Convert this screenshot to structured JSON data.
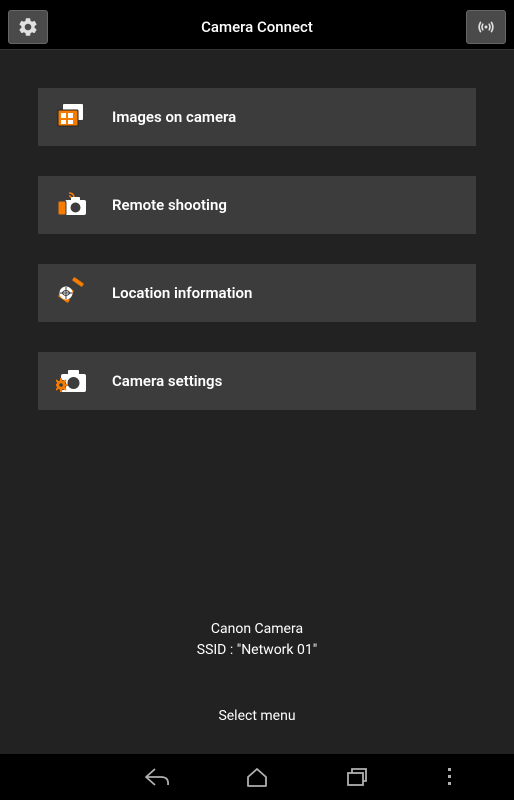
{
  "header": {
    "title": "Camera Connect"
  },
  "menu": {
    "items": [
      {
        "label": "Images on camera",
        "icon": "images-icon"
      },
      {
        "label": "Remote shooting",
        "icon": "remote-icon"
      },
      {
        "label": "Location information",
        "icon": "location-icon"
      },
      {
        "label": "Camera settings",
        "icon": "settings-icon"
      }
    ]
  },
  "status": {
    "device": "Canon Camera",
    "ssid_line": "SSID : \"Network 01\""
  },
  "prompt": "Select menu",
  "colors": {
    "accent": "#f57c00",
    "bg": "#222222",
    "item_bg": "#3c3c3c"
  }
}
